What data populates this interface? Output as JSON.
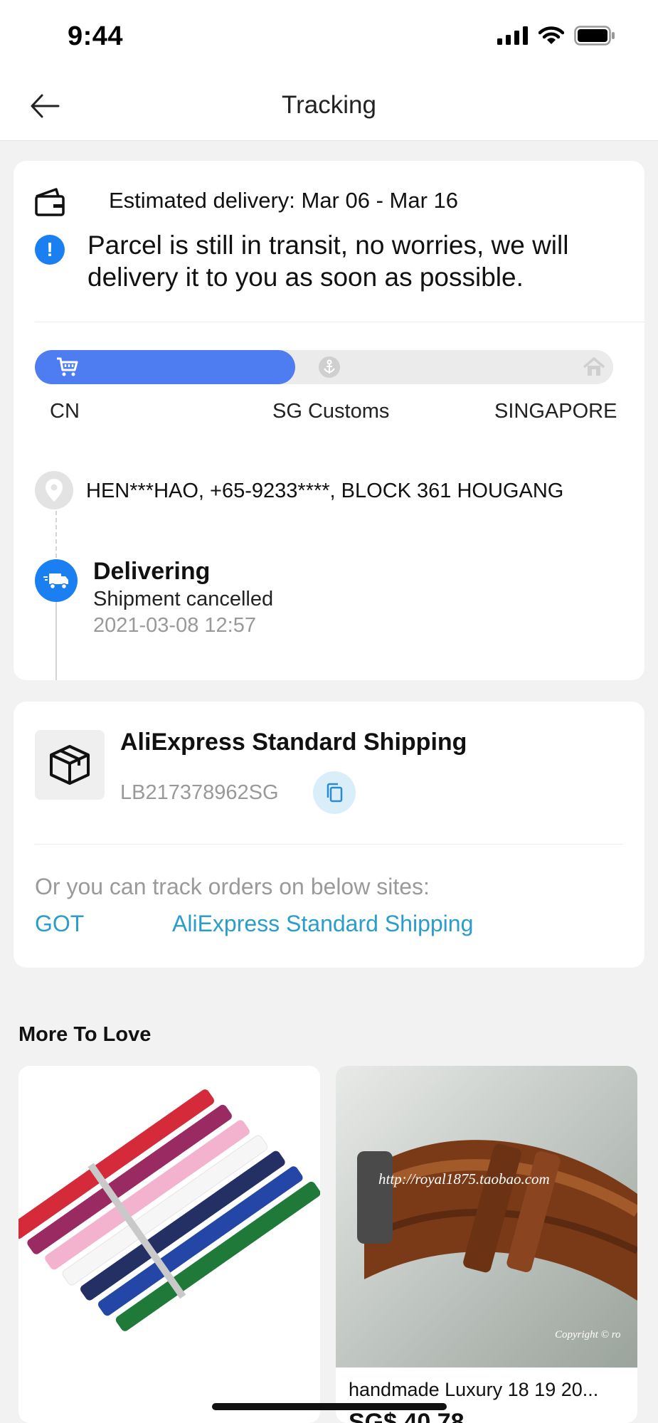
{
  "status_bar": {
    "time": "9:44"
  },
  "header": {
    "title": "Tracking"
  },
  "delivery": {
    "estimated": "Estimated delivery: Mar 06 - Mar 16",
    "message": "Parcel is still in transit, no worries, we will delivery it to you as soon as possible.",
    "progress_stages": [
      "CN",
      "SG Customs",
      "SINGAPORE"
    ],
    "progress_fraction": 0.45,
    "accent_color": "#4e7df2",
    "address": "HEN***HAO,  +65-9233****,  BLOCK 361 HOUGANG",
    "event": {
      "title": "Delivering",
      "description": "Shipment cancelled",
      "time": "2021-03-08 12:57"
    }
  },
  "shipping": {
    "name": "AliExpress Standard Shipping",
    "tracking_number": "LB217378962SG",
    "hint": "Or you can track orders on below sites:",
    "links": [
      "GOT",
      "AliExpress Standard Shipping"
    ],
    "link_color": "#2a9dcc"
  },
  "more_to_love": {
    "title": "More To Love",
    "products": [
      {
        "name": "",
        "price": ""
      },
      {
        "name": "handmade Luxury 18 19 20...",
        "price": "SG$ 40.78",
        "image_watermark": "http://royal1875.taobao.com",
        "image_copyright": "Copyright © ro"
      }
    ]
  }
}
